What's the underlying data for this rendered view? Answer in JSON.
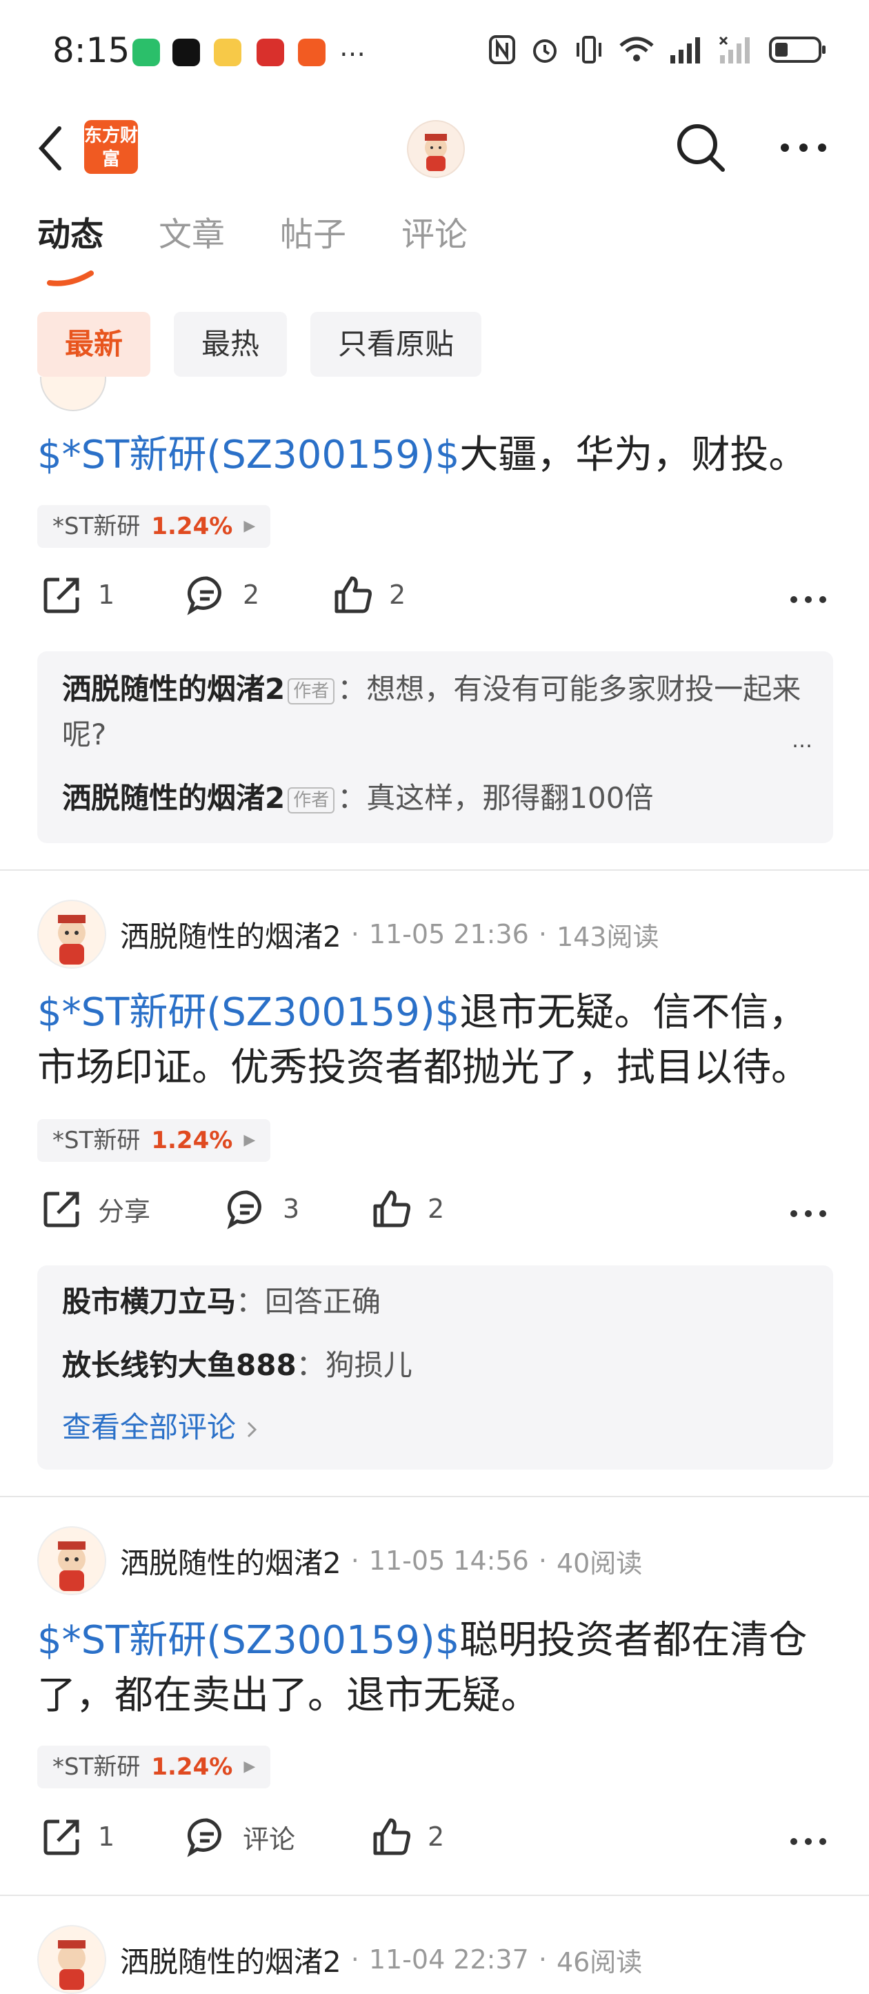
{
  "status_bar": {
    "time": "8:15",
    "app_icon_label": "…"
  },
  "header": {
    "logo_text": "东方财富"
  },
  "tabs": [
    {
      "label": "动态"
    },
    {
      "label": "文章"
    },
    {
      "label": "帖子"
    },
    {
      "label": "评论"
    }
  ],
  "filters": [
    {
      "label": "最新"
    },
    {
      "label": "最热"
    },
    {
      "label": "只看原贴"
    }
  ],
  "posts": [
    {
      "stock_link": "$*ST新研(SZ300159)$",
      "text": "大疆，华为，财投。",
      "tag": {
        "name": "*ST新研",
        "pct": "1.24%"
      },
      "share": "1",
      "comments": "2",
      "likes": "2",
      "comment_list": [
        {
          "name": "洒脱随性的烟渚2",
          "tag": "作者",
          "text": "想想，有没有可能多家财投一起来呢?"
        },
        {
          "name": "洒脱随性的烟渚2",
          "tag": "作者",
          "text": "真这样，那得翻100倍"
        }
      ]
    },
    {
      "author": "洒脱随性的烟渚2",
      "time": "11-05 21:36",
      "reads": "143阅读",
      "stock_link": "$*ST新研(SZ300159)$",
      "text": "退市无疑。信不信，市场印证。优秀投资者都抛光了，拭目以待。",
      "tag": {
        "name": "*ST新研",
        "pct": "1.24%"
      },
      "share": "分享",
      "comments": "3",
      "likes": "2",
      "comment_list": [
        {
          "name": "股市横刀立马",
          "text": "回答正确"
        },
        {
          "name": "放长线钓大鱼888",
          "text": "狗损儿"
        }
      ],
      "view_all": "查看全部评论"
    },
    {
      "author": "洒脱随性的烟渚2",
      "time": "11-05 14:56",
      "reads": "40阅读",
      "stock_link": "$*ST新研(SZ300159)$",
      "text": "聪明投资者都在清仓了，都在卖出了。退市无疑。",
      "tag": {
        "name": "*ST新研",
        "pct": "1.24%"
      },
      "share": "1",
      "comments": "评论",
      "likes": "2"
    },
    {
      "author": "洒脱随性的烟渚2",
      "time": "11-04 22:37",
      "reads": "46阅读"
    }
  ],
  "colors": {
    "accent": "#e8551e",
    "link": "#2a70c8",
    "up": "#e04a20"
  }
}
